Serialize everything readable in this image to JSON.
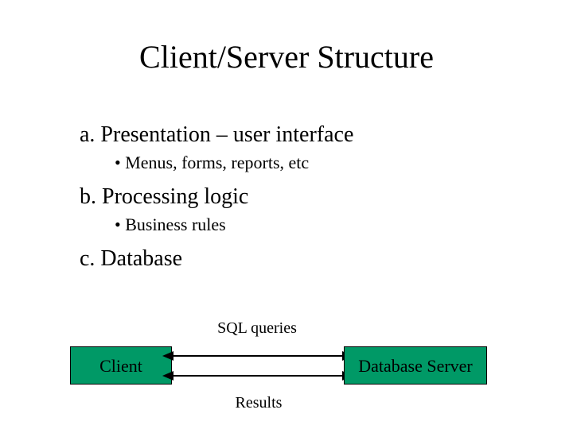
{
  "title": "Client/Server Structure",
  "list": {
    "a": {
      "text": "a. Presentation – user interface",
      "sub": "Menus, forms, reports, etc"
    },
    "b": {
      "text": "b. Processing logic",
      "sub": "Business rules"
    },
    "c": {
      "text": "c. Database"
    }
  },
  "diagram": {
    "client": "Client",
    "server": "Database Server",
    "top_label": "SQL queries",
    "bottom_label": "Results"
  }
}
